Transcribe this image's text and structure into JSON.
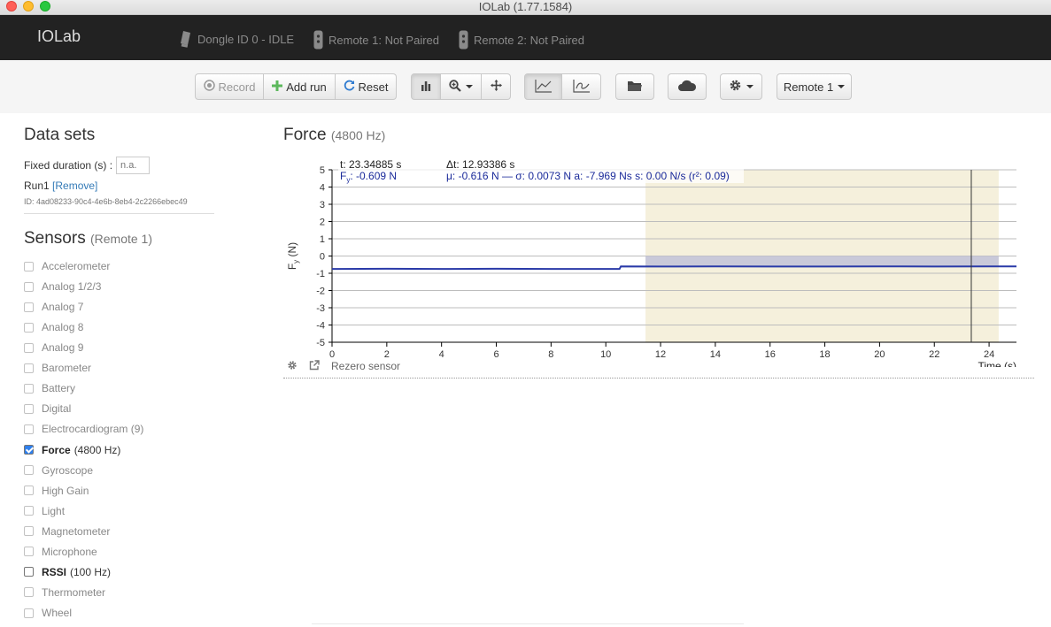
{
  "window": {
    "title": "IOLab (1.77.1584)"
  },
  "navbar": {
    "brand": "IOLab",
    "dongle": "Dongle ID 0 - IDLE",
    "remote1": "Remote 1: Not Paired",
    "remote2": "Remote 2: Not Paired"
  },
  "toolbar": {
    "record": "Record",
    "add_run": "Add run",
    "reset": "Reset",
    "remote_select": "Remote 1"
  },
  "datasets": {
    "heading": "Data sets",
    "fixed_duration_label": "Fixed duration (s) :",
    "fixed_duration_placeholder": "n.a.",
    "run_name": "Run1",
    "remove_label": "[Remove]",
    "run_id": "ID: 4ad08233-90c4-4e6b-8eb4-2c2266ebec49"
  },
  "sensors": {
    "heading": "Sensors",
    "sub": "(Remote 1)",
    "items": [
      {
        "label": "Accelerometer",
        "rate": "",
        "checked": false,
        "bold": false
      },
      {
        "label": "Analog 1/2/3",
        "rate": "",
        "checked": false,
        "bold": false
      },
      {
        "label": "Analog 7",
        "rate": "",
        "checked": false,
        "bold": false
      },
      {
        "label": "Analog 8",
        "rate": "",
        "checked": false,
        "bold": false
      },
      {
        "label": "Analog 9",
        "rate": "",
        "checked": false,
        "bold": false
      },
      {
        "label": "Barometer",
        "rate": "",
        "checked": false,
        "bold": false
      },
      {
        "label": "Battery",
        "rate": "",
        "checked": false,
        "bold": false
      },
      {
        "label": "Digital",
        "rate": "",
        "checked": false,
        "bold": false
      },
      {
        "label": "Electrocardiogram (9)",
        "rate": "",
        "checked": false,
        "bold": false
      },
      {
        "label": "Force",
        "rate": "(4800 Hz)",
        "checked": true,
        "bold": true
      },
      {
        "label": "Gyroscope",
        "rate": "",
        "checked": false,
        "bold": false
      },
      {
        "label": "High Gain",
        "rate": "",
        "checked": false,
        "bold": false
      },
      {
        "label": "Light",
        "rate": "",
        "checked": false,
        "bold": false
      },
      {
        "label": "Magnetometer",
        "rate": "",
        "checked": false,
        "bold": false
      },
      {
        "label": "Microphone",
        "rate": "",
        "checked": false,
        "bold": false
      },
      {
        "label": "RSSI",
        "rate": "(100 Hz)",
        "checked": false,
        "bold": true
      },
      {
        "label": "Thermometer",
        "rate": "",
        "checked": false,
        "bold": false
      },
      {
        "label": "Wheel",
        "rate": "",
        "checked": false,
        "bold": false
      }
    ]
  },
  "chart": {
    "title": "Force",
    "rate": "(4800 Hz)",
    "cursor_time": "t: 23.34885 s",
    "cursor_value": "F",
    "cursor_value_sub": "y",
    "cursor_value_rest": ": -0.609 N",
    "delta_t": "Δt: 12.93386 s",
    "stats": "μ: -0.616 N — σ: 0.0073 N   a: -7.969 Ns   s: 0.00 N/s (r²: 0.09)",
    "rezero": "Rezero sensor",
    "colors": {
      "line": "#2a3aa8",
      "selection": "#f5f0dc",
      "mean_band": "#c4c4d8",
      "text_blue": "#1a2a9a"
    }
  },
  "chart_data": {
    "type": "line",
    "title": "",
    "xlabel": "Time (s)",
    "ylabel": "F_y (N)",
    "xlim": [
      0,
      25
    ],
    "ylim": [
      -5,
      5
    ],
    "xticks": [
      0,
      2,
      4,
      6,
      8,
      10,
      12,
      14,
      16,
      18,
      20,
      22,
      24
    ],
    "yticks": [
      5,
      4,
      3,
      2,
      1,
      0,
      -1,
      -2,
      -3,
      -4,
      -5
    ],
    "grid": true,
    "series": [
      {
        "x": [
          0,
          2,
          4,
          6,
          8,
          10,
          10.5,
          10.55,
          12,
          14,
          16,
          18,
          20,
          22,
          24,
          25
        ],
        "y": [
          -0.75,
          -0.74,
          -0.75,
          -0.74,
          -0.75,
          -0.75,
          -0.75,
          -0.6,
          -0.61,
          -0.6,
          -0.61,
          -0.61,
          -0.6,
          -0.61,
          -0.6,
          -0.6
        ]
      }
    ],
    "selection": {
      "x_start": 11.45,
      "x_end": 24.35
    },
    "cursor_x": 23.35,
    "mean_band": {
      "y_from": -0.62,
      "y_to": 0
    }
  }
}
